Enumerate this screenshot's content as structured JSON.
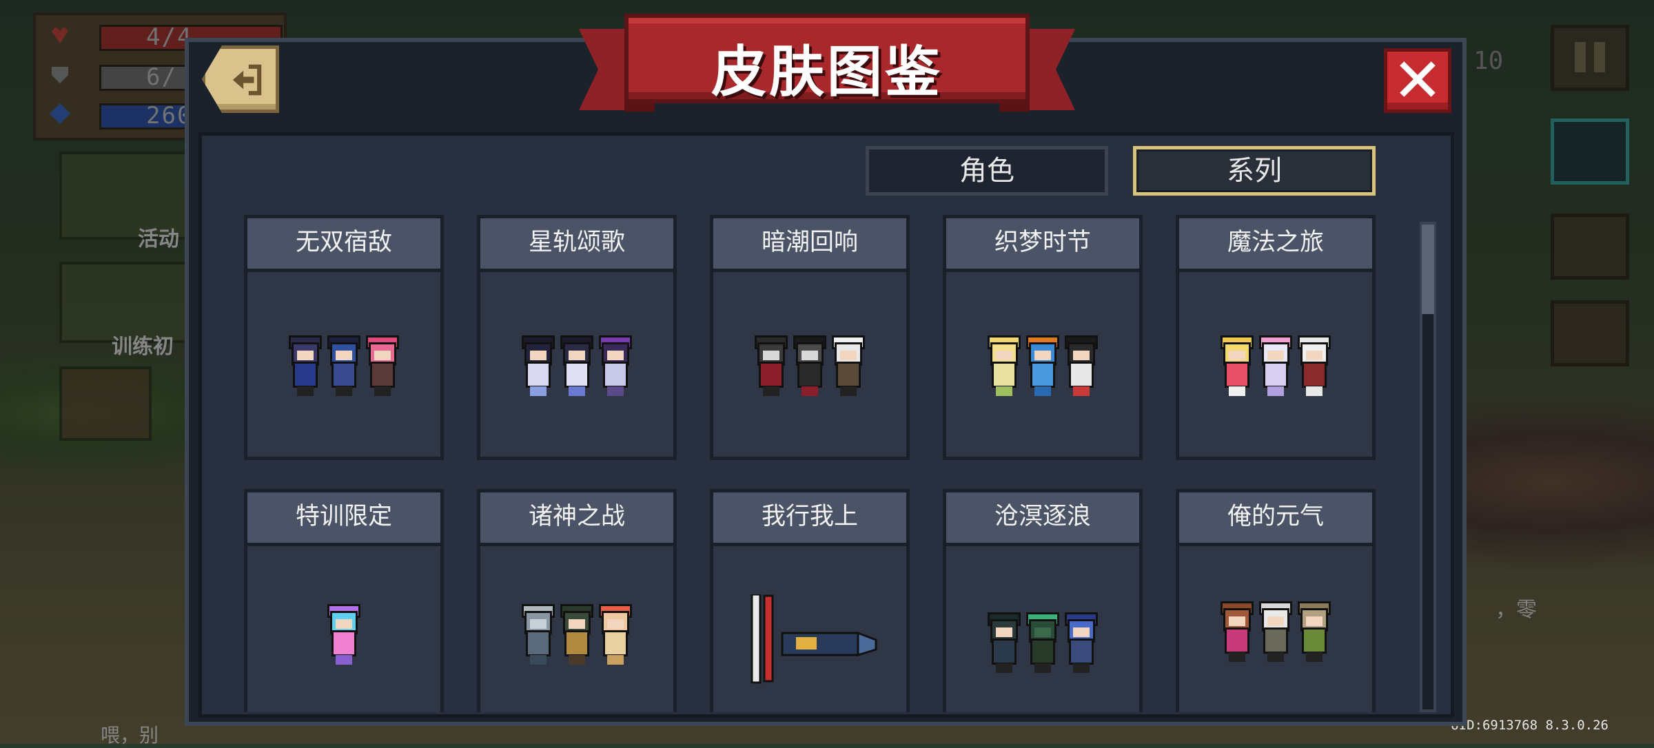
{
  "hud": {
    "hp": "4/4",
    "armor": "6/",
    "energy": "260/",
    "left_label_1": "活动",
    "left_label_2": "训练初",
    "bottom_chat": "喂，别",
    "right_code": "10",
    "uid": "UID:6913768 8.3.0.26",
    "right_text": "，零"
  },
  "dialog": {
    "title": "皮肤图鉴",
    "tabs": [
      {
        "label": "角色",
        "active": false
      },
      {
        "label": "系列",
        "active": true
      }
    ],
    "series": [
      {
        "name": "无双宿敌"
      },
      {
        "name": "星轨颂歌"
      },
      {
        "name": "暗潮回响"
      },
      {
        "name": "织梦时节"
      },
      {
        "name": "魔法之旅"
      },
      {
        "name": "特训限定"
      },
      {
        "name": "诸神之战"
      },
      {
        "name": "我行我上"
      },
      {
        "name": "沧溟逐浪"
      },
      {
        "name": "俺的元气"
      }
    ]
  },
  "colors": {
    "ribbon": "#a8282c",
    "close": "#c72c30",
    "active_tab_border": "#d8c47a",
    "card_header": "#4a5466"
  },
  "icons": {
    "back": "back-arrow-icon",
    "close": "close-x-icon",
    "pause": "pause-icon"
  }
}
